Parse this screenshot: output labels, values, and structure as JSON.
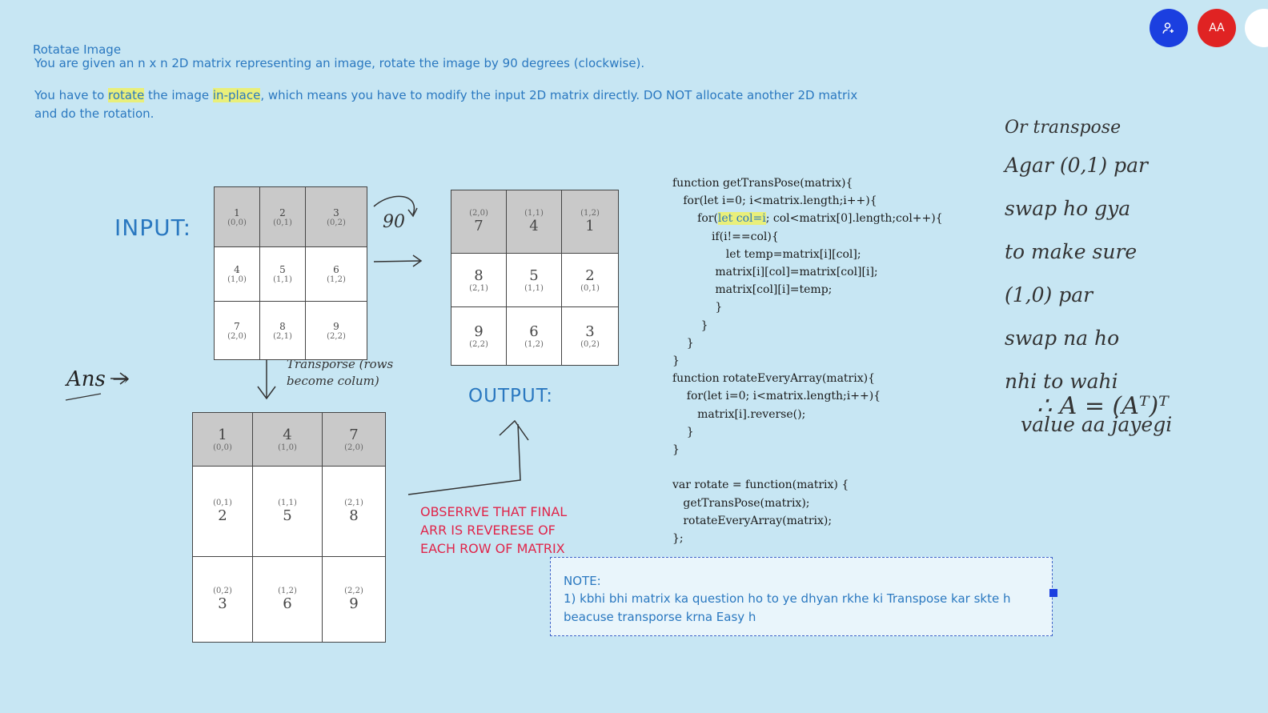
{
  "header": {
    "title": "Rotatae Image",
    "desc1": "You are given an n x n 2D matrix representing an image, rotate the image by 90 degrees (clockwise).",
    "desc2_part1": "You have to ",
    "desc2_hl1": "rotate",
    "desc2_part2": " the image ",
    "desc2_hl2": "in-place",
    "desc2_part3": ", which means you have to modify the input 2D matrix directly. DO NOT allocate another 2D matrix and do the rotation."
  },
  "avatars": {
    "aa_label": "AA",
    "user_icon": "person-add-icon"
  },
  "labels": {
    "input": "INPUT:",
    "output": "OUTPUT:",
    "ninety": "90",
    "ans": "Ans →",
    "transpose_note": "Transporse (rows become colum)",
    "observe_note": "OBSERRVE THAT FINAL ARR IS REVERESE OF EACH ROW OF MATRIX"
  },
  "matrix_input": [
    [
      {
        "v": "1",
        "i": "(0,0)"
      },
      {
        "v": "2",
        "i": "(0,1)"
      },
      {
        "v": "3",
        "i": "(0,2)"
      }
    ],
    [
      {
        "v": "4",
        "i": "(1,0)"
      },
      {
        "v": "5",
        "i": "(1,1)"
      },
      {
        "v": "6",
        "i": "(1,2)"
      }
    ],
    [
      {
        "v": "7",
        "i": "(2,0)"
      },
      {
        "v": "8",
        "i": "(2,1)"
      },
      {
        "v": "9",
        "i": "(2,2)"
      }
    ]
  ],
  "matrix_output": [
    [
      {
        "v": "7",
        "i": "(2,0)"
      },
      {
        "v": "4",
        "i": "(1,1)"
      },
      {
        "v": "1",
        "i": "(1,2)"
      }
    ],
    [
      {
        "v": "8",
        "i": "(2,1)"
      },
      {
        "v": "5",
        "i": "(1,1)"
      },
      {
        "v": "2",
        "i": "(0,1)"
      }
    ],
    [
      {
        "v": "9",
        "i": "(2,2)"
      },
      {
        "v": "6",
        "i": "(1,2)"
      },
      {
        "v": "3",
        "i": "(0,2)"
      }
    ]
  ],
  "matrix_transpose": [
    [
      {
        "v": "1",
        "i": "(0,0)"
      },
      {
        "v": "4",
        "i": "(1,0)"
      },
      {
        "v": "7",
        "i": "(2,0)"
      }
    ],
    [
      {
        "v": "2",
        "i": "(0,1)"
      },
      {
        "v": "5",
        "i": "(1,1)"
      },
      {
        "v": "8",
        "i": "(2,1)"
      }
    ],
    [
      {
        "v": "3",
        "i": "(0,2)"
      },
      {
        "v": "6",
        "i": "(1,2)"
      },
      {
        "v": "9",
        "i": "(2,2)"
      }
    ]
  ],
  "code": {
    "l1": "function getTransPose(matrix){",
    "l2": "   for(let i=0; i<matrix.length;i++){",
    "l3a": "       for(",
    "l3hl": "let col=i",
    "l3b": "; col<matrix[0].length;col++){",
    "l4": "           if(i!==col){",
    "l5": "               let temp=matrix[i][col];",
    "l6": "            matrix[i][col]=matrix[col][i];",
    "l7": "            matrix[col][i]=temp;",
    "l8": "            }",
    "l9": "        }",
    "l10": "    }",
    "l11": "}",
    "l12": "function rotateEveryArray(matrix){",
    "l13": "    for(let i=0; i<matrix.length;i++){",
    "l14": "       matrix[i].reverse();",
    "l15": "    }",
    "l16": "}",
    "l17": "",
    "l18": "var rotate = function(matrix) {",
    "l19": "   getTransPose(matrix);",
    "l20": "   rotateEveryArray(matrix);",
    "l21": "};"
  },
  "notes_right": {
    "l1": "Or transpose",
    "l2": "Agar (0,1) par",
    "l3": "swap ho gya",
    "l4": "to make sure",
    "l5": "(1,0) par",
    "l6": "swap na ho",
    "l7": "nhi to wahi",
    "l8": "value aa jayegi",
    "formula": "∴ A = (Aᵀ)ᵀ"
  },
  "note_box": {
    "title": "NOTE:",
    "line": "1) kbhi bhi matrix ka question ho to ye dhyan rkhe ki Transpose kar skte h beacuse transporse krna Easy h"
  }
}
